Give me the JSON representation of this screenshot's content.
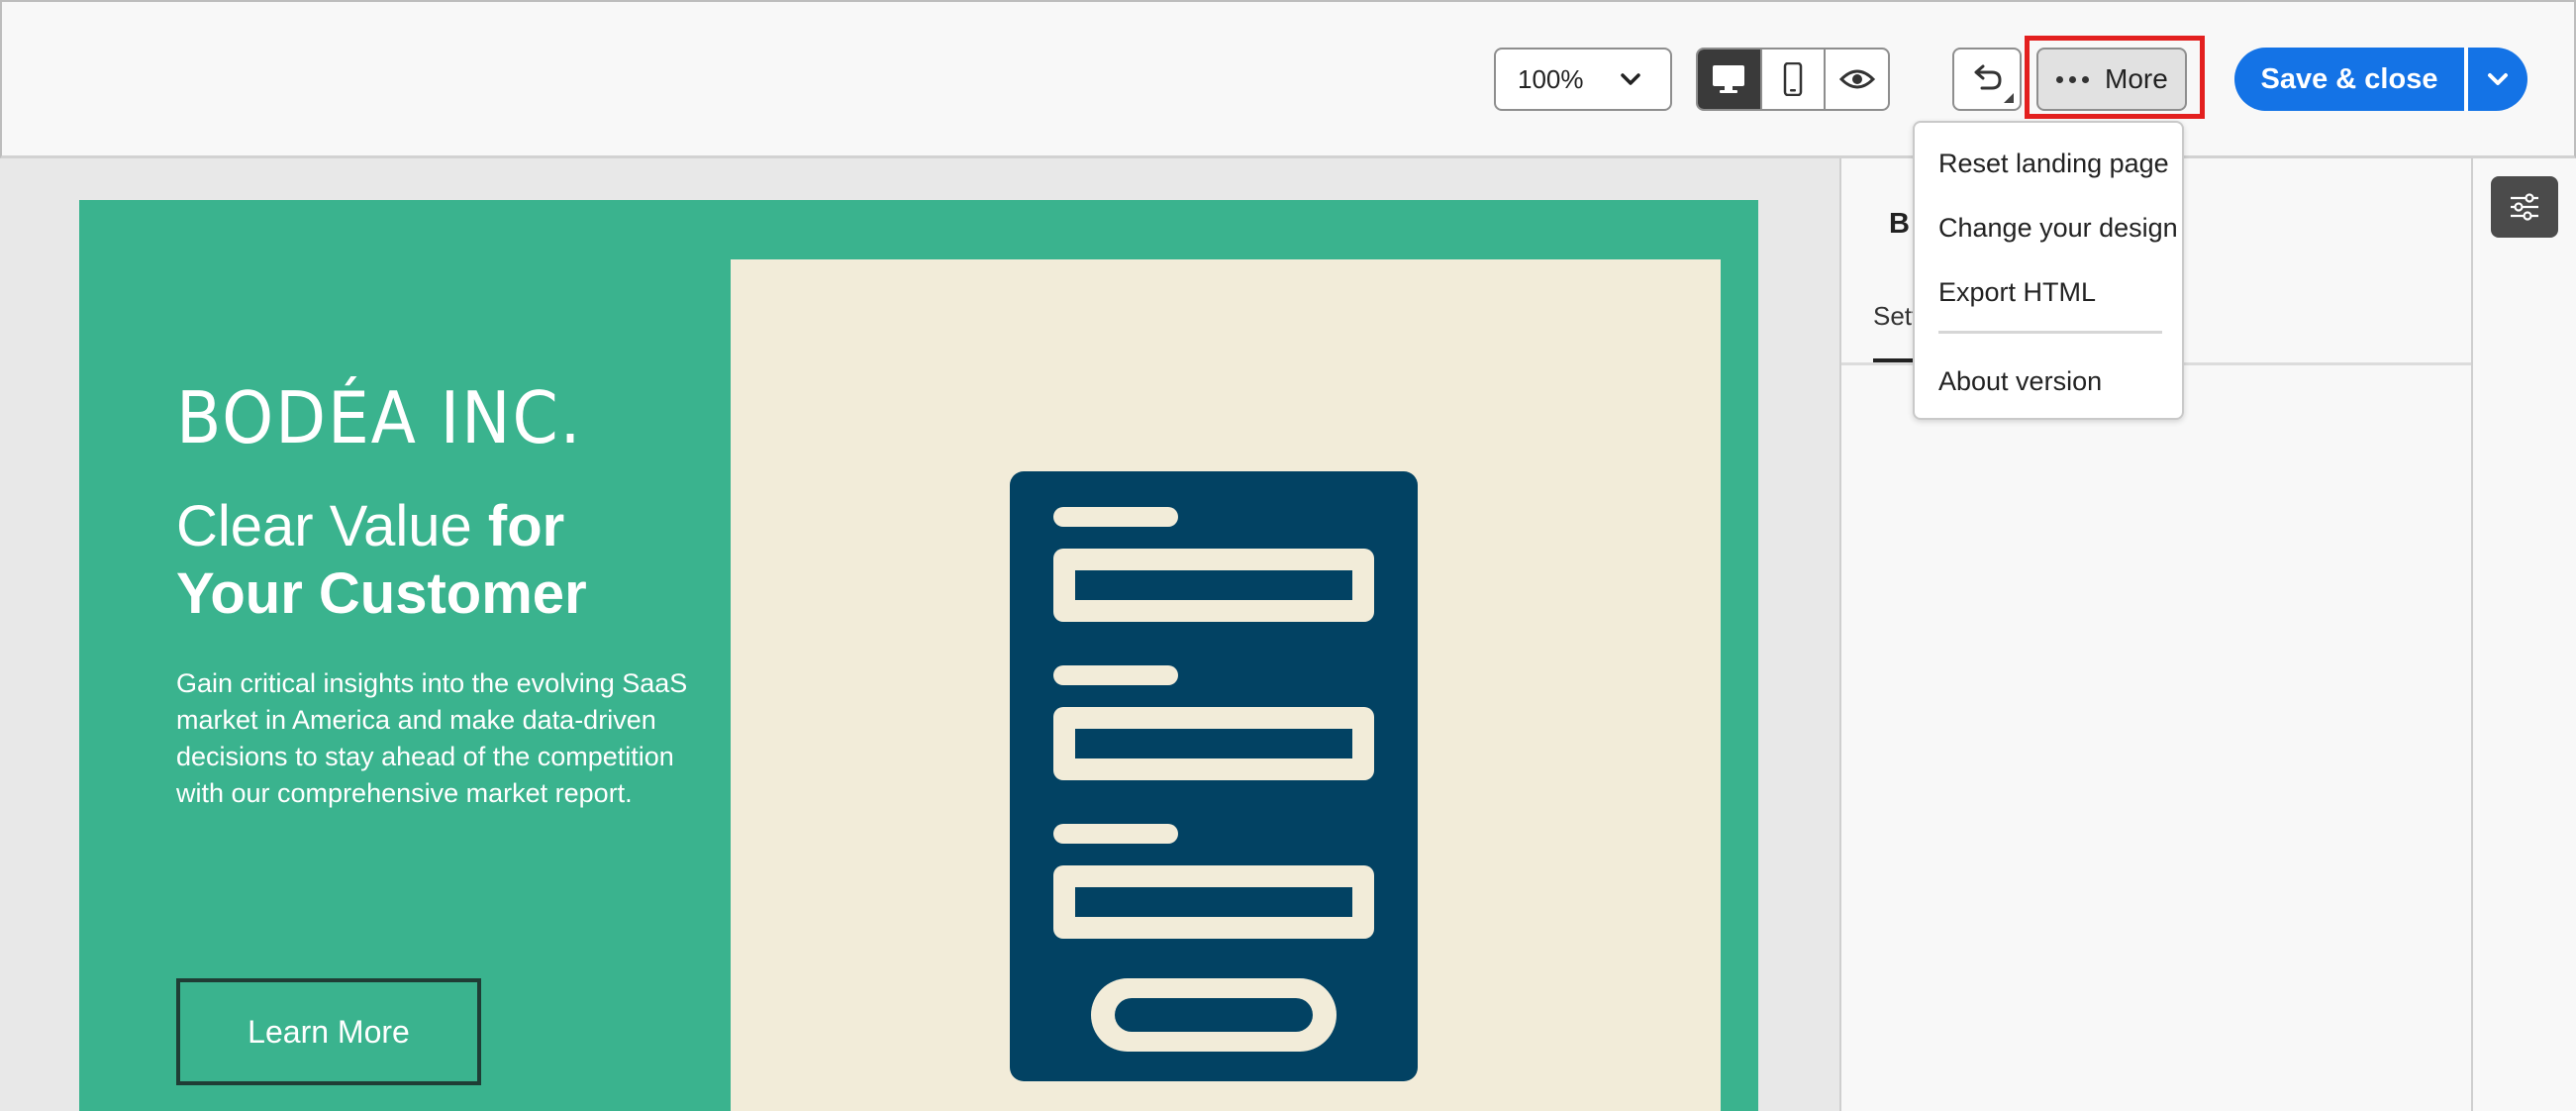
{
  "toolbar": {
    "zoom_value": "100%",
    "more_label": "More",
    "save_label": "Save & close"
  },
  "more_menu": {
    "items": [
      "Reset landing page",
      "Change your design",
      "Export HTML",
      "About version"
    ]
  },
  "landing_page": {
    "logo_text": "BODÉA INC.",
    "headline_light": "Clear Value ",
    "headline_bold_1": "for",
    "headline_bold_2": "Your Customer",
    "body_text": "Gain critical insights into the evolving SaaS market in America and make data-driven decisions to stay ahead of the competition with our comprehensive market report.",
    "cta_label": "Learn More"
  },
  "right_panel": {
    "title_visible": "B",
    "tab_visible": "Sett"
  },
  "colors": {
    "brand_green": "#3ab38e",
    "image_bg": "#f2ecd9",
    "form_navy": "#024263",
    "primary_blue": "#1473e6",
    "highlight_red": "#e3201f"
  }
}
